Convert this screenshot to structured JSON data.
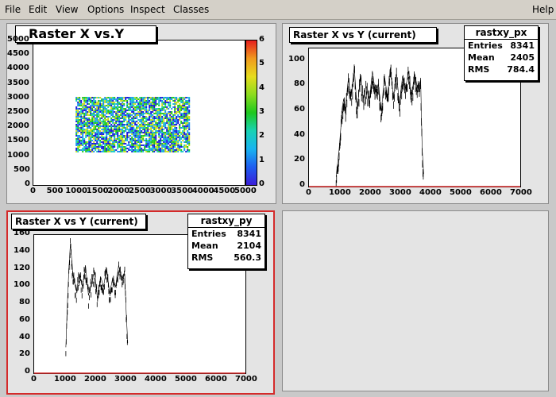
{
  "menu": {
    "file": "File",
    "edit": "Edit",
    "view": "View",
    "options": "Options",
    "inspect": "Inspect",
    "classes": "Classes",
    "help": "Help"
  },
  "pads": {
    "top_left": {
      "title": "Raster X vs.Y",
      "x_ticks": [
        "0",
        "500",
        "1000",
        "1500",
        "2000",
        "2500",
        "3000",
        "3500",
        "4000",
        "4500",
        "5000"
      ],
      "y_ticks": [
        "1000",
        "1500",
        "2000",
        "2500",
        "3000",
        "3500",
        "4000",
        "4500",
        "5000"
      ],
      "y_extra": "500",
      "y_zero": "0",
      "z_ticks": [
        "0",
        "1",
        "2",
        "3",
        "4",
        "5",
        "6"
      ]
    },
    "top_right": {
      "title": "Raster X vs Y (current)",
      "stats": {
        "name": "rastxy_px",
        "entries_label": "Entries",
        "entries": "8341",
        "mean_label": "Mean",
        "mean": "2405",
        "rms_label": "RMS",
        "rms": "784.4"
      },
      "x_ticks": [
        "0",
        "1000",
        "2000",
        "3000",
        "4000",
        "5000",
        "6000",
        "7000"
      ],
      "y_ticks": [
        "0",
        "20",
        "40",
        "60",
        "80",
        "100"
      ]
    },
    "bottom_left": {
      "title": "Raster X vs Y (current)",
      "stats": {
        "name": "rastxy_py",
        "entries_label": "Entries",
        "entries": "8341",
        "mean_label": "Mean",
        "mean": "2104",
        "rms_label": "RMS",
        "rms": "560.3"
      },
      "x_ticks": [
        "0",
        "1000",
        "2000",
        "3000",
        "4000",
        "5000",
        "6000",
        "7000"
      ],
      "y_ticks": [
        "0",
        "20",
        "40",
        "60",
        "80",
        "100",
        "120",
        "140",
        "160"
      ]
    }
  },
  "chart_data": [
    {
      "type": "heatmap",
      "title": "Raster X vs.Y",
      "xlim": [
        0,
        5000
      ],
      "ylim": [
        0,
        5000
      ],
      "zlim": [
        0,
        6
      ],
      "filled_region": {
        "x": [
          1000,
          3700
        ],
        "y": [
          1150,
          3050
        ]
      },
      "colors": [
        "#1a1adb",
        "#1a8ff0",
        "#19c8c8",
        "#1ec81e",
        "#c8dc1e",
        "#f0961e",
        "#e61e1e"
      ]
    },
    {
      "type": "line",
      "title": "Raster X vs Y (current)",
      "name": "rastxy_px",
      "xlim": [
        0,
        7000
      ],
      "ylim": [
        0,
        110
      ],
      "x": [
        900,
        1000,
        1050,
        1100,
        1150,
        1200,
        1300,
        1400,
        1500,
        1600,
        1700,
        1800,
        1900,
        2000,
        2100,
        2200,
        2300,
        2400,
        2500,
        2600,
        2700,
        2800,
        2900,
        3000,
        3100,
        3200,
        3300,
        3400,
        3500,
        3600,
        3700,
        3750,
        3800
      ],
      "values": [
        8,
        30,
        45,
        62,
        70,
        60,
        85,
        72,
        95,
        60,
        88,
        70,
        80,
        68,
        92,
        75,
        82,
        60,
        88,
        72,
        95,
        70,
        90,
        65,
        88,
        78,
        92,
        72,
        90,
        78,
        85,
        30,
        10
      ]
    },
    {
      "type": "line",
      "title": "Raster X vs Y (current)",
      "name": "rastxy_py",
      "xlim": [
        0,
        7000
      ],
      "ylim": [
        0,
        160
      ],
      "x": [
        1050,
        1100,
        1150,
        1200,
        1250,
        1300,
        1400,
        1500,
        1600,
        1700,
        1800,
        1900,
        2000,
        2100,
        2200,
        2300,
        2400,
        2500,
        2600,
        2700,
        2800,
        2900,
        3000,
        3050,
        3100
      ],
      "values": [
        30,
        80,
        120,
        150,
        130,
        110,
        95,
        115,
        100,
        125,
        90,
        105,
        118,
        85,
        112,
        100,
        122,
        92,
        110,
        100,
        125,
        108,
        115,
        70,
        35
      ]
    }
  ]
}
